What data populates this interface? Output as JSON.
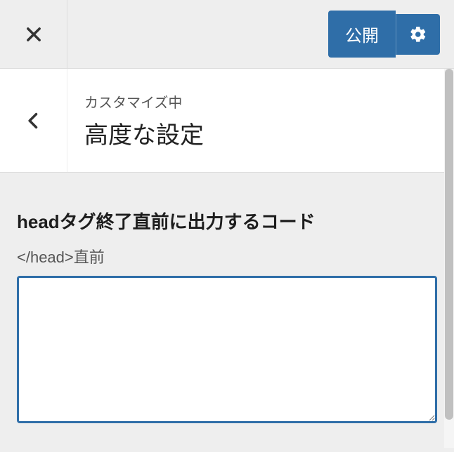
{
  "topbar": {
    "publish_label": "公開"
  },
  "section": {
    "breadcrumb": "カスタマイズ中",
    "title": "高度な設定"
  },
  "field": {
    "title": "headタグ終了直前に出力するコード",
    "description": "</head>直前",
    "value": ""
  }
}
